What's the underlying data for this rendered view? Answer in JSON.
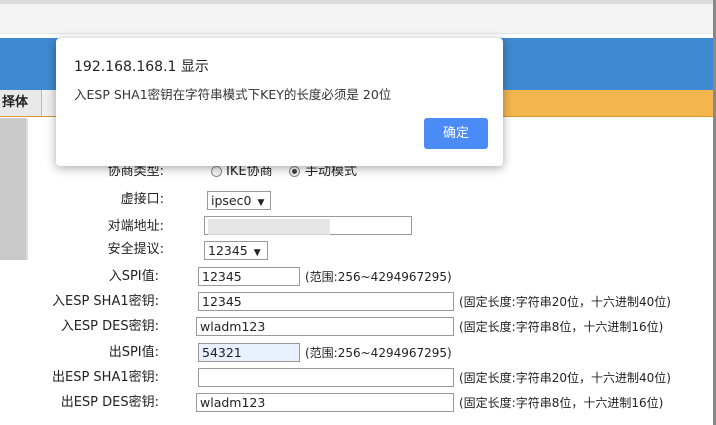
{
  "menu": {
    "tab_label": "择体"
  },
  "dialog": {
    "title": "192.168.168.1 显示",
    "message": "入ESP SHA1密钥在字符串模式下KEY的长度必须是 20位",
    "ok_label": "确定"
  },
  "form": {
    "negotiation": {
      "label": "协商类型:",
      "options": [
        "IKE协商",
        "手动模式"
      ],
      "selected": "手动模式"
    },
    "virtual_interface": {
      "label": "虚接口:",
      "value": "ipsec0"
    },
    "peer_address": {
      "label": "对端地址:",
      "value": ""
    },
    "security_proposal": {
      "label": "安全提议:",
      "value": "12345"
    },
    "in_spi": {
      "label": "入SPI值:",
      "value": "12345",
      "hint": "(范围:256~4294967295)"
    },
    "in_esp_sha1_key": {
      "label": "入ESP SHA1密钥:",
      "value": "12345",
      "hint": "(固定长度:字符串20位，十六进制40位)"
    },
    "in_esp_des_key": {
      "label": "入ESP DES密钥:",
      "value": "wladm123",
      "hint": "(固定长度:字符串8位，十六进制16位)"
    },
    "out_spi": {
      "label": "出SPI值:",
      "value": "54321",
      "hint": "(范围:256~4294967295)"
    },
    "out_esp_sha1_key": {
      "label": "出ESP SHA1密钥:",
      "value": "",
      "hint": "(固定长度:字符串20位，十六进制40位)"
    },
    "out_esp_des_key": {
      "label": "出ESP DES密钥:",
      "value": "wladm123",
      "hint": "(固定长度:字符串8位，十六进制16位)"
    }
  },
  "colors": {
    "banner": "#3e8ad0",
    "menubar": "#f5b54f",
    "ok_button": "#4a8bf5"
  }
}
